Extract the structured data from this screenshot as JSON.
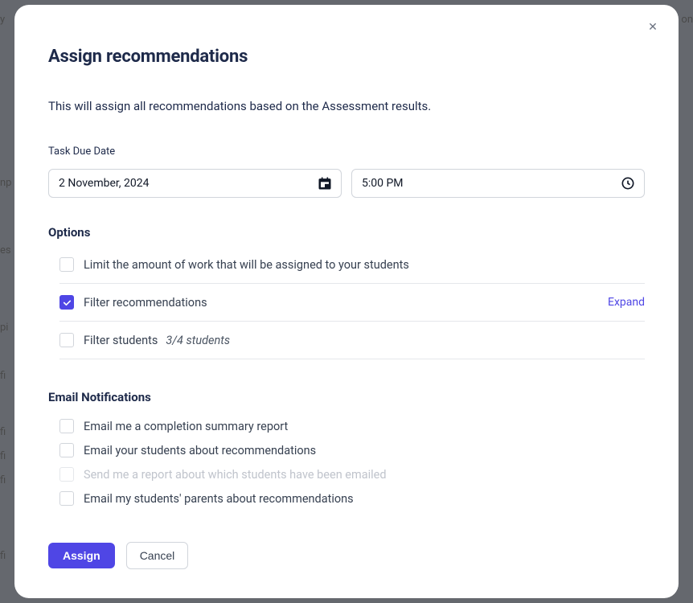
{
  "modal": {
    "title": "Assign recommendations",
    "description": "This will assign all recommendations based on the Assessment results.",
    "close_icon_name": "close-icon"
  },
  "due": {
    "label": "Task Due Date",
    "date_value": "2 November, 2024",
    "time_value": "5:00 PM"
  },
  "options": {
    "heading": "Options",
    "limit": {
      "label": "Limit the amount of work that will be assigned to your students",
      "checked": false
    },
    "filter_recommendations": {
      "label": "Filter recommendations",
      "checked": true,
      "expand_label": "Expand"
    },
    "filter_students": {
      "label": "Filter students",
      "sub": "3/4 students",
      "checked": false
    }
  },
  "notifications": {
    "heading": "Email Notifications",
    "email_me": {
      "label": "Email me a completion summary report",
      "checked": false
    },
    "email_students": {
      "label": "Email your students about recommendations",
      "checked": false
    },
    "report_emailed": {
      "label": "Send me a report about which students have been emailed",
      "checked": false,
      "disabled": true
    },
    "email_parents": {
      "label": "Email my students' parents about recommendations",
      "checked": false
    }
  },
  "actions": {
    "primary": "Assign",
    "secondary": "Cancel"
  }
}
